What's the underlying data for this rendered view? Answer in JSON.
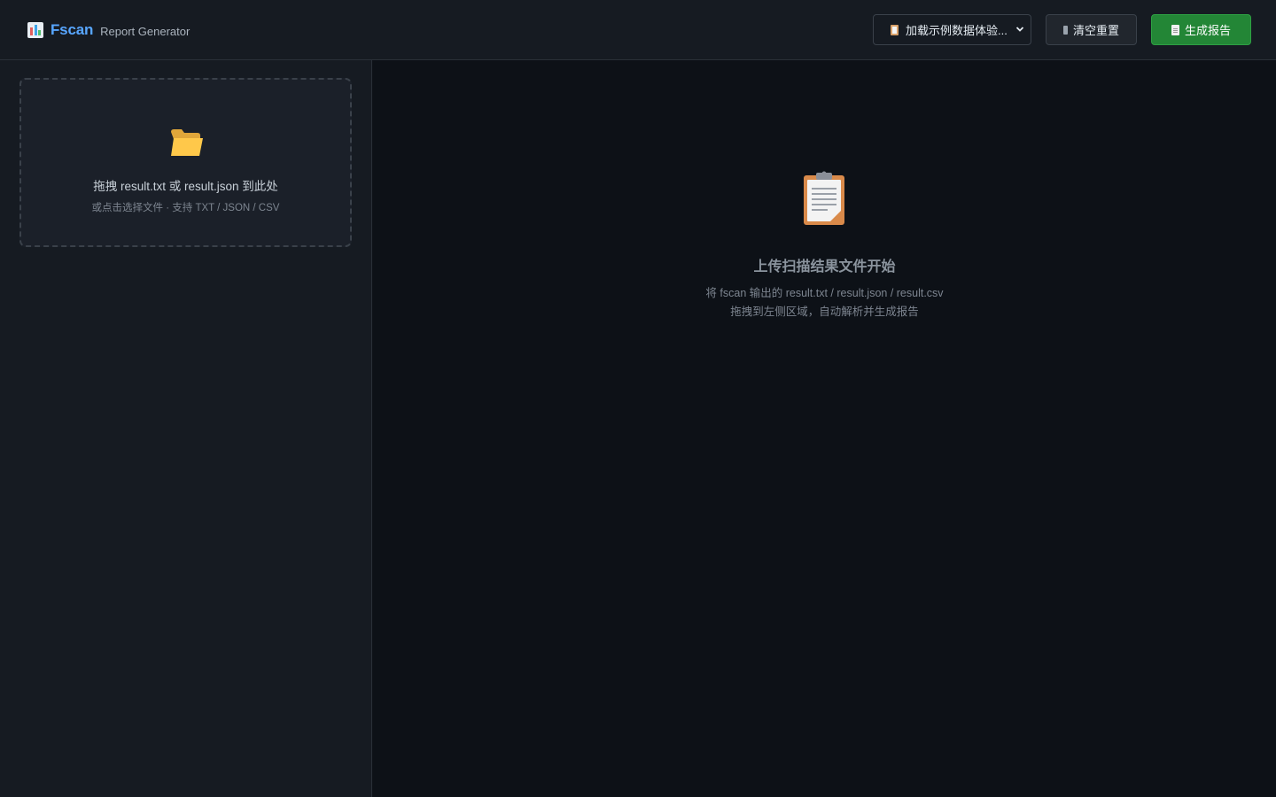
{
  "header": {
    "brand_name": "Fscan",
    "brand_subtitle": "Report Generator",
    "sample_select_label": "加载示例数据体验...",
    "clear_label": "清空重置",
    "generate_label": "生成报告"
  },
  "sidebar": {
    "dropzone": {
      "title": "拖拽 result.txt 或 result.json 到此处",
      "subtitle": "或点击选择文件 · 支持 TXT / JSON / CSV"
    }
  },
  "main": {
    "empty_state": {
      "title": "上传扫描结果文件开始",
      "line1": "将 fscan 输出的 result.txt / result.json / result.csv",
      "line2": "拖拽到左侧区域，自动解析并生成报告"
    }
  },
  "icons": {
    "brand": "bar-chart-icon",
    "select": "clipboard-icon",
    "clear": "trash-icon",
    "generate": "document-icon",
    "dropzone": "folder-icon",
    "empty_state": "clipboard-icon"
  },
  "colors": {
    "accent": "#58a6ff",
    "primary_button": "#238636",
    "background": "#0d1117",
    "panel": "#161b22"
  }
}
